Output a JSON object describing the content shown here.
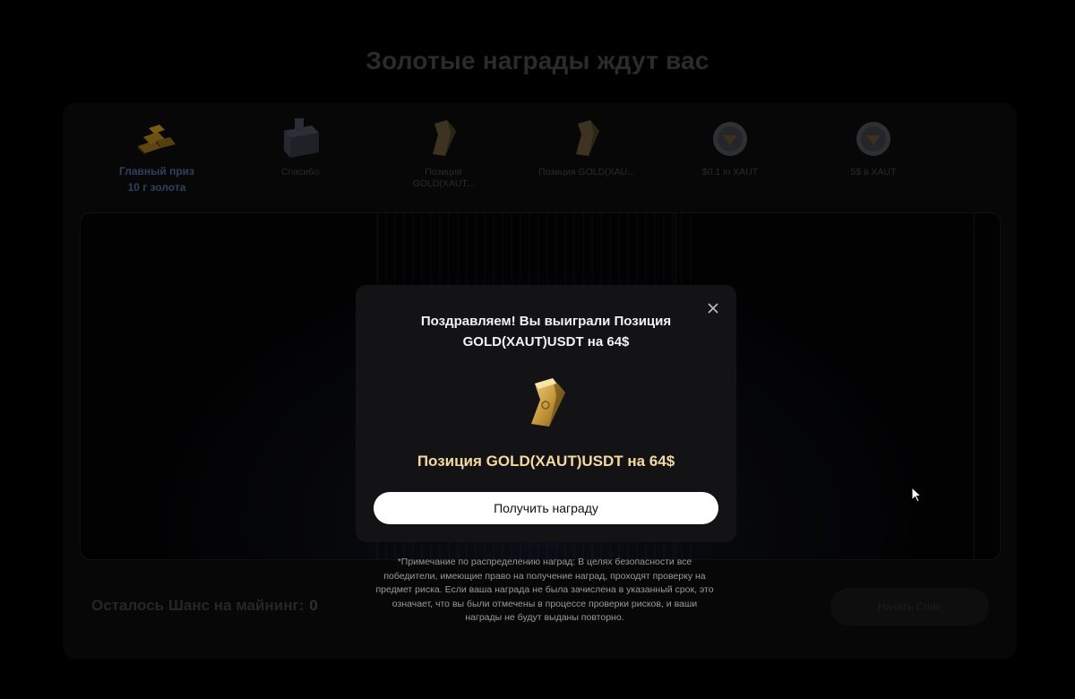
{
  "page": {
    "title": "Золотые награды ждут вас"
  },
  "prizes": [
    {
      "label": "Главный приз\n10 г золота",
      "icon": "gold-bars-icon",
      "main": true
    },
    {
      "label": "Спасибо",
      "icon": "gift-box-icon",
      "main": false
    },
    {
      "label": "Позиция GOLD(XAUT...",
      "icon": "gold-ingot-icon",
      "main": false
    },
    {
      "label": "Позиция GOLD(XAU...",
      "icon": "gold-ingot-icon",
      "main": false
    },
    {
      "label": "$0.1 in XAUT",
      "icon": "diamond-coin-icon",
      "main": false
    },
    {
      "label": "5$ в XAUT",
      "icon": "diamond-coin-icon",
      "main": false
    }
  ],
  "footer": {
    "chance_label": "Осталось Шанс на майнинг:",
    "chance_count": "0",
    "button_label": "Начать Спин"
  },
  "note": "*Примечание по распределению наград: В целях безопасности все победители, имеющие право на получение наград, проходят проверку на предмет риска. Если ваша награда не была зачислена в указанный срок, это означает, что вы были отмечены в процессе проверки рисков, и ваши награды не будут выданы повторно.",
  "modal": {
    "title": "Поздравляем! Вы выиграли Позиция GOLD(XAUT)USDT на 64$",
    "prize_name": "Позиция GOLD(XAUT)USDT на 64$",
    "claim_button": "Получить награду",
    "icon": "gold-ingot-icon"
  },
  "colors": {
    "accent_gold": "#f3d9a1",
    "background": "#000000",
    "modal_bg": "#131315"
  }
}
